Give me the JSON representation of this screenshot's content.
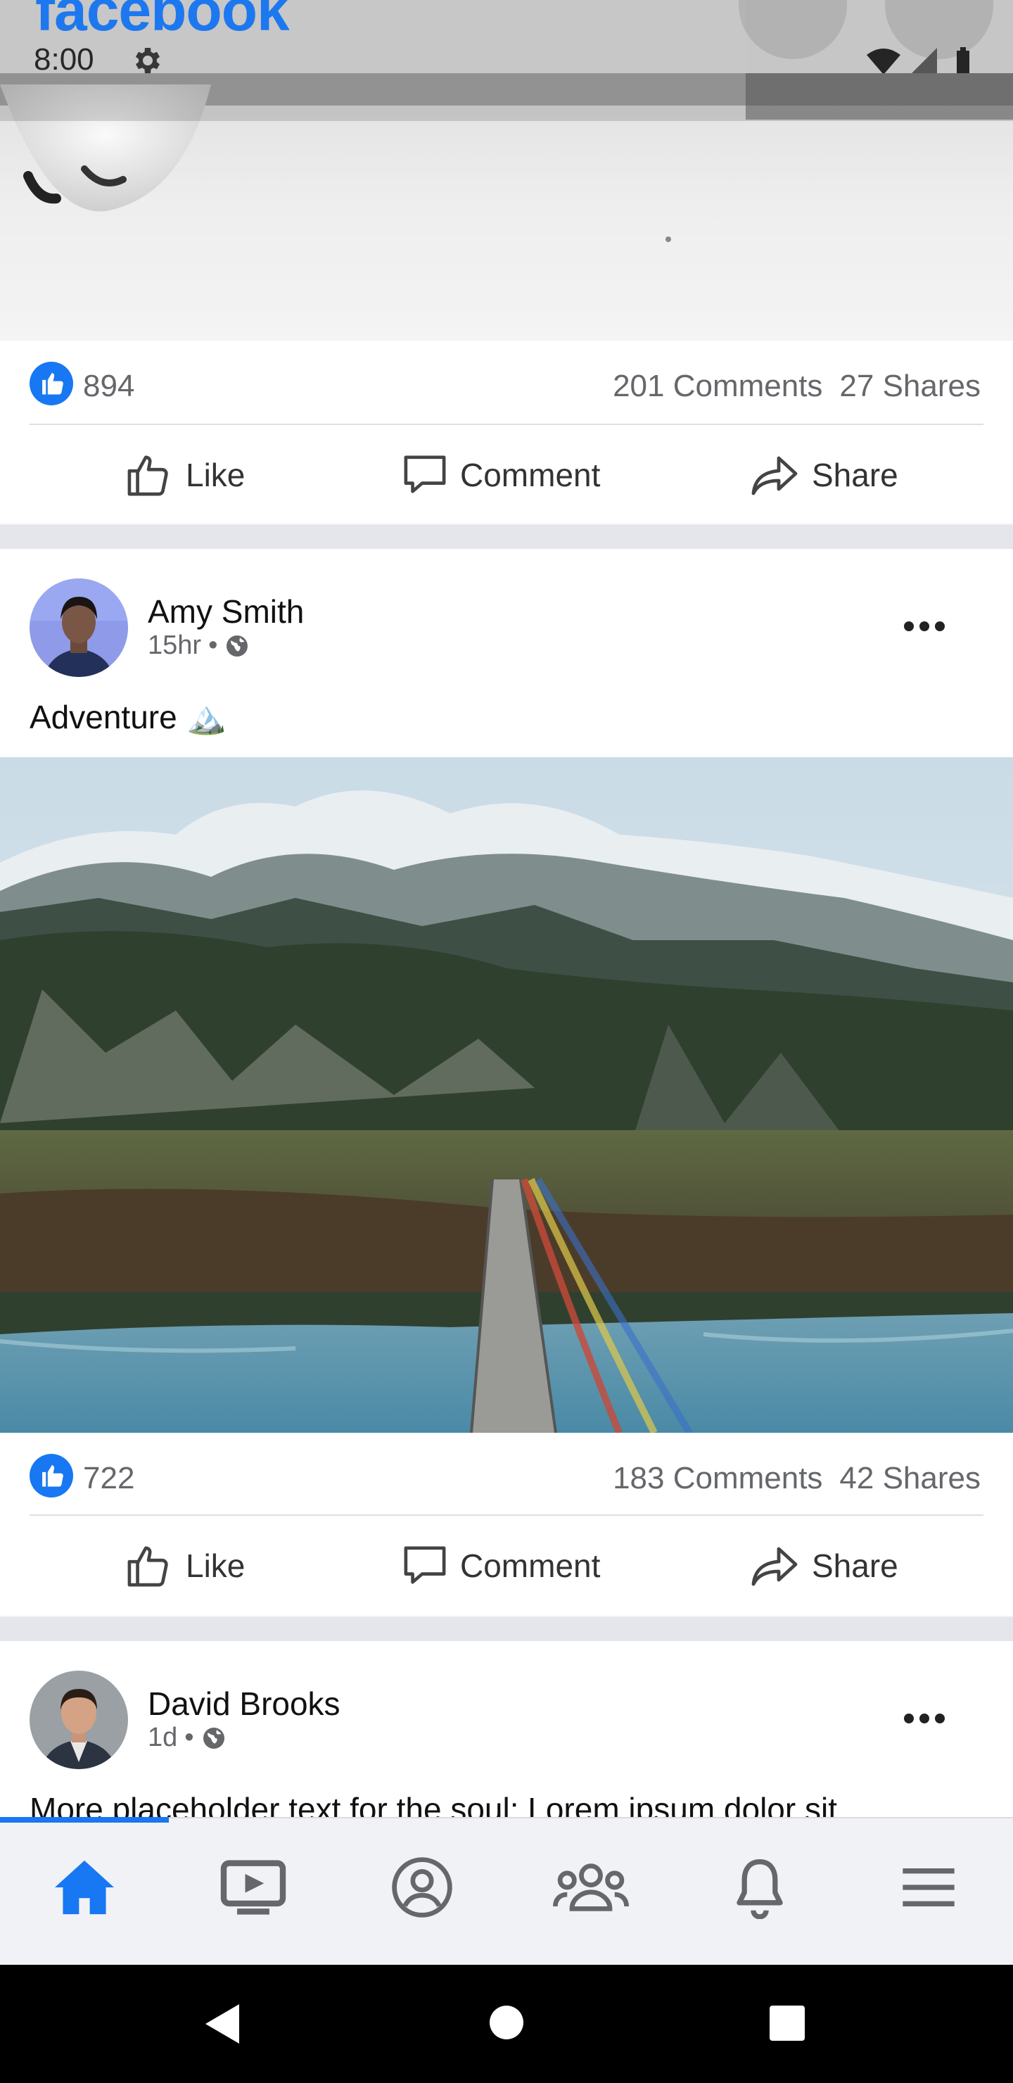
{
  "header": {
    "app_logo": "facebook",
    "status_time": "8:00",
    "icons": [
      "gear-icon",
      "wifi-icon",
      "signal-icon",
      "battery-icon"
    ]
  },
  "posts": [
    {
      "image": "dog-paw-photo",
      "likes": "894",
      "comments": "201 Comments",
      "shares": "27 Shares",
      "actions": {
        "like": "Like",
        "comment": "Comment",
        "share": "Share"
      }
    },
    {
      "author": "Amy Smith",
      "time": "15hr",
      "dot": "•",
      "text": "Adventure 🏔️",
      "image": "mountain-bridge-photo",
      "likes": "722",
      "comments": "183 Comments",
      "shares": "42 Shares",
      "actions": {
        "like": "Like",
        "comment": "Comment",
        "share": "Share"
      }
    },
    {
      "author": "David Brooks",
      "time": "1d",
      "dot": "•",
      "text": "More placeholder text for the soul: Lorem ipsum dolor sit"
    }
  ],
  "bottom_nav": {
    "items": [
      "home-icon",
      "video-icon",
      "profile-icon",
      "groups-icon",
      "notifications-icon",
      "menu-icon"
    ],
    "active": "home-icon",
    "active_color": "#1877f2",
    "inactive_color": "#65676b"
  },
  "system_nav": [
    "back-icon",
    "home-circle-icon",
    "recents-icon"
  ],
  "colors": {
    "brand": "#1877f2",
    "background": "#f0f2f5",
    "text_secondary": "#65676b"
  }
}
